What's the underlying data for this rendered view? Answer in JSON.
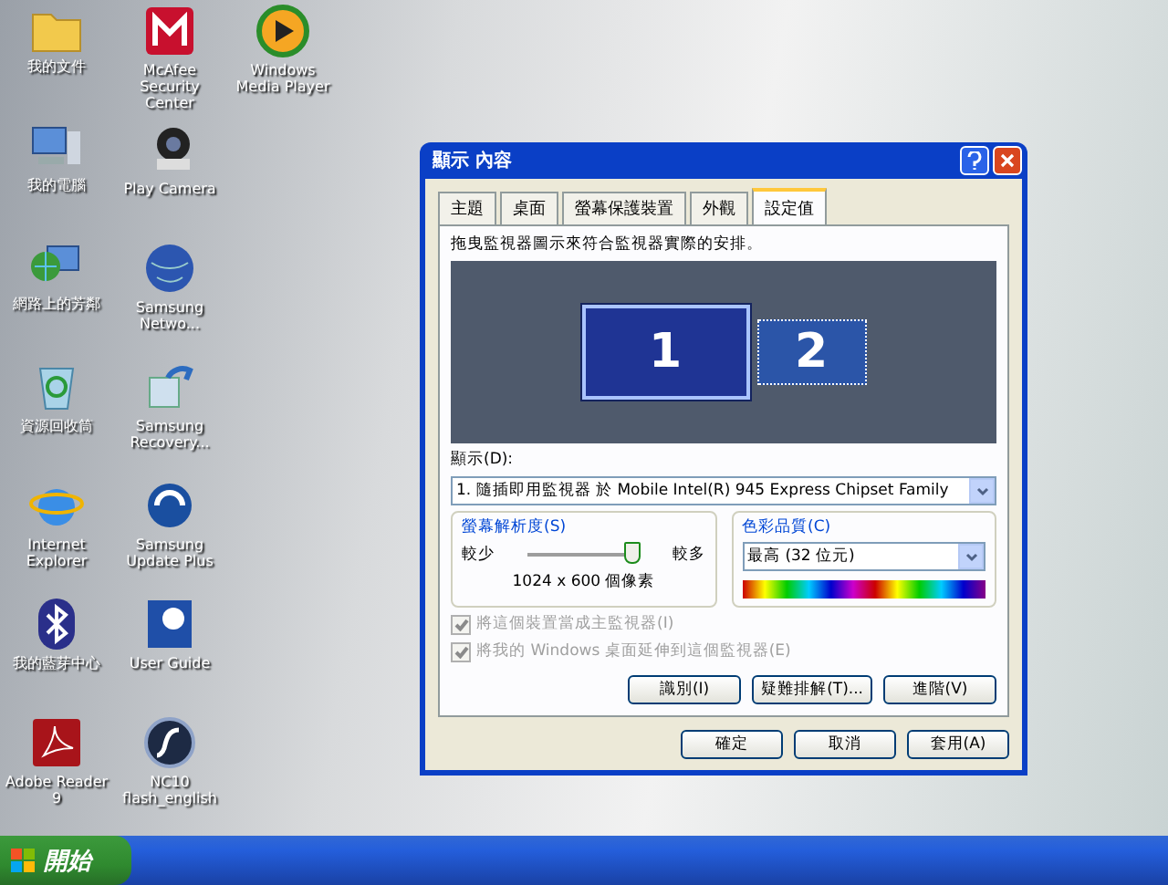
{
  "desktop_icons": [
    {
      "label": "我的文件"
    },
    {
      "label": "McAfee Security Center"
    },
    {
      "label": "Windows Media Player"
    },
    {
      "label": "我的電腦"
    },
    {
      "label": "Play Camera"
    },
    {
      "label": "網路上的芳鄰"
    },
    {
      "label": "Samsung Netwo..."
    },
    {
      "label": "資源回收筒"
    },
    {
      "label": "Samsung Recovery..."
    },
    {
      "label": "Internet Explorer"
    },
    {
      "label": "Samsung Update Plus"
    },
    {
      "label": "我的藍芽中心"
    },
    {
      "label": "User Guide"
    },
    {
      "label": "Adobe Reader 9"
    },
    {
      "label": "NC10 flash_english"
    }
  ],
  "window": {
    "title": "顯示 內容",
    "tabs": [
      {
        "label": "主題",
        "selected": false
      },
      {
        "label": "桌面",
        "selected": false
      },
      {
        "label": "螢幕保護裝置",
        "selected": false
      },
      {
        "label": "外觀",
        "selected": false
      },
      {
        "label": "設定值",
        "selected": true
      }
    ],
    "instruction": "拖曳監視器圖示來符合監視器實際的安排。",
    "monitors": [
      {
        "label": "1",
        "selected": true
      },
      {
        "label": "2",
        "selected": false
      }
    ],
    "display_label": "顯示(D):",
    "display_value": "1. 隨插即用監視器 於 Mobile Intel(R) 945 Express Chipset Family",
    "resolution": {
      "title": "螢幕解析度(S)",
      "less": "較少",
      "more": "較多",
      "level": 1,
      "reading": "1024 x 600 個像素"
    },
    "color_quality": {
      "title": "色彩品質(C)",
      "value": "最高 (32 位元)"
    },
    "checkboxes": [
      {
        "label": "將這個裝置當成主監視器(I)",
        "checked": true,
        "disabled": true
      },
      {
        "label": "將我的 Windows 桌面延伸到這個監視器(E)",
        "checked": true,
        "disabled": true
      }
    ],
    "buttons": [
      "識別(I)",
      "疑難排解(T)...",
      "進階(V)"
    ],
    "footer_buttons": [
      "確定",
      "取消",
      "套用(A)"
    ]
  },
  "taskbar": {
    "start": "開始"
  }
}
